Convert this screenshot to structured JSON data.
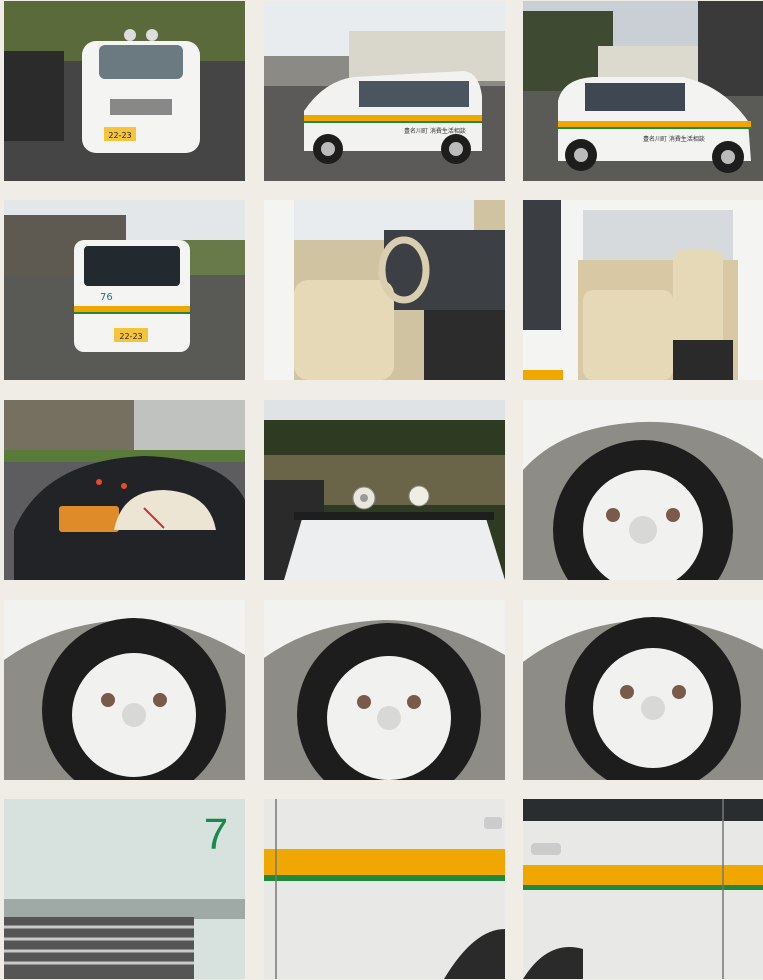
{
  "photos": [
    {
      "subject": "front-view",
      "plate": "22-23"
    },
    {
      "subject": "left-side-view",
      "door_text": "豊名川町 消費生活相談"
    },
    {
      "subject": "right-side-view",
      "door_text": "豊名川町 消費生活相談"
    },
    {
      "subject": "rear-view",
      "badge": "76",
      "plate": "22-23"
    },
    {
      "subject": "driver-seat-interior"
    },
    {
      "subject": "rear-seat-interior"
    },
    {
      "subject": "instrument-cluster"
    },
    {
      "subject": "roof-loudspeakers"
    },
    {
      "subject": "front-right-wheel"
    },
    {
      "subject": "front-left-wheel"
    },
    {
      "subject": "rear-left-wheel"
    },
    {
      "subject": "rear-right-wheel"
    },
    {
      "subject": "hood-grille",
      "mark": "7"
    },
    {
      "subject": "left-door-panel"
    },
    {
      "subject": "right-door-panel"
    }
  ],
  "colors": {
    "background": "#efede6",
    "body_white": "#f2f2f0",
    "stripe_yellow": "#f0a800",
    "stripe_green": "#1e8a3a",
    "asphalt": "#4a4a48",
    "seat_beige": "#e6d9b8",
    "tire": "#1d1d1d"
  }
}
